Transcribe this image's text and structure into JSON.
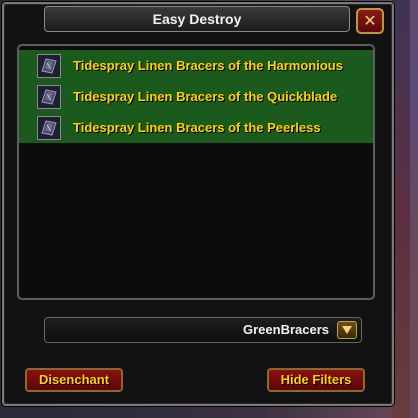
{
  "window": {
    "title": "Easy Destroy"
  },
  "icons": {
    "close": "close-icon",
    "item": "bracers-item-icon",
    "dropdown": "chevron-down-icon"
  },
  "items": [
    {
      "name": "Tidespray Linen Bracers of the Harmonious"
    },
    {
      "name": "Tidespray Linen Bracers of the Quickblade"
    },
    {
      "name": "Tidespray Linen Bracers of the Peerless"
    }
  ],
  "filter": {
    "selected": "GreenBracers"
  },
  "buttons": {
    "disenchant": "Disenchant",
    "hide_filters": "Hide Filters"
  },
  "colors": {
    "item_text": "#ffd200",
    "row_highlight": "#1a5a1c",
    "button_red": "#8c1010"
  }
}
